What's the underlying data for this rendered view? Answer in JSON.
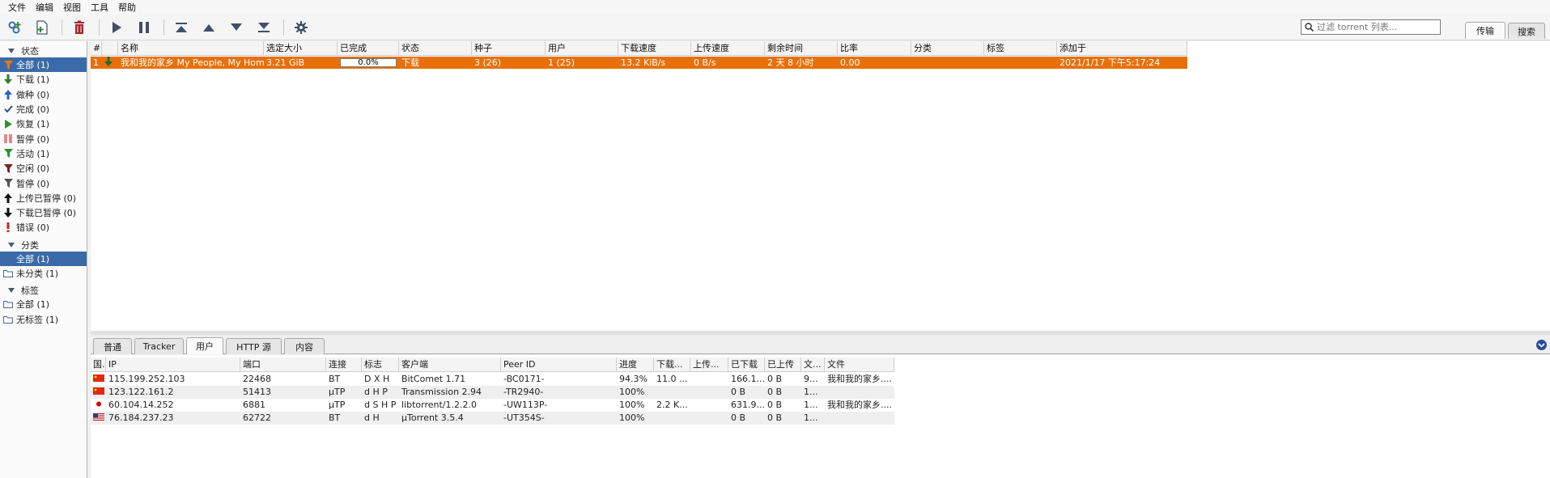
{
  "menubar": [
    "文件",
    "编辑",
    "视图",
    "工具",
    "帮助"
  ],
  "toolbar": {
    "filter_placeholder": "过滤 torrent 列表...",
    "tabs": [
      "传输",
      "搜索"
    ]
  },
  "sidebar": {
    "status_header": "状态",
    "status_items": [
      {
        "label": "全部 (1)",
        "icon": "filter-icon"
      },
      {
        "label": "下载 (1)",
        "icon": "download-arrow-icon"
      },
      {
        "label": "做种 (0)",
        "icon": "upload-arrow-icon"
      },
      {
        "label": "完成 (0)",
        "icon": "check-icon"
      },
      {
        "label": "恢复 (1)",
        "icon": "play-icon"
      },
      {
        "label": "暂停 (0)",
        "icon": "pause-icon"
      },
      {
        "label": "活动 (1)",
        "icon": "filter-icon"
      },
      {
        "label": "空闲 (0)",
        "icon": "filter-icon"
      },
      {
        "label": "暂停 (0)",
        "icon": "filter-icon"
      },
      {
        "label": "上传已暂停 (0)",
        "icon": "up-arrow-icon"
      },
      {
        "label": "下载已暂停 (0)",
        "icon": "down-arrow-icon"
      },
      {
        "label": "错误 (0)",
        "icon": "error-icon"
      }
    ],
    "category_header": "分类",
    "category_items": [
      "全部 (1)",
      "未分类 (1)"
    ],
    "tag_header": "标签",
    "tag_items": [
      "全部 (1)",
      "无标签 (1)"
    ]
  },
  "torrents": {
    "headers": [
      "#",
      "",
      "名称",
      "选定大小",
      "已完成",
      "状态",
      "种子",
      "用户",
      "下载速度",
      "上传速度",
      "剩余时间",
      "比率",
      "分类",
      "标签",
      "添加于"
    ],
    "rows": [
      {
        "num": "1",
        "name": "我和我的家乡 My People, My Hom...",
        "size": "3.21 GiB",
        "progress": "0.0%",
        "status": "下载",
        "seeds": "3 (26)",
        "peers": "1 (25)",
        "dl_speed": "13.2 KiB/s",
        "ul_speed": "0 B/s",
        "eta": "2 天 8 小时",
        "ratio": "0.00",
        "category": "",
        "tags": "",
        "added": "2021/1/17 下午5:17:24"
      }
    ]
  },
  "bottom_tabs": [
    "普通",
    "Tracker",
    "用户",
    "HTTP 源",
    "内容"
  ],
  "peers": {
    "headers": [
      "国.",
      "IP",
      "端口",
      "连接",
      "标志",
      "客户端",
      "Peer ID",
      "进度",
      "下载...",
      "上传...",
      "已下载",
      "已上传",
      "文...",
      "文件"
    ],
    "rows": [
      {
        "ip": "115.199.252.103",
        "port": "22468",
        "conn": "BT",
        "flags": "D X H",
        "client": "BitComet 1.71",
        "peer_id": "-BC0171-",
        "progress": "94.3%",
        "dl": "11.0 ...",
        "ul": "",
        "downloaded": "166.1...",
        "uploaded": "0 B",
        "files": "9...",
        "file": "我和我的家乡...."
      },
      {
        "ip": "123.122.161.2",
        "port": "51413",
        "conn": "μTP",
        "flags": "d H P",
        "client": "Transmission 2.94",
        "peer_id": "-TR2940-",
        "progress": "100%",
        "dl": "",
        "ul": "",
        "downloaded": "0 B",
        "uploaded": "0 B",
        "files": "1...",
        "file": ""
      },
      {
        "ip": "60.104.14.252",
        "port": "6881",
        "conn": "μTP",
        "flags": "d S H P",
        "client": "libtorrent/1.2.2.0",
        "peer_id": "-UW113P-",
        "progress": "100%",
        "dl": "2.2 K...",
        "ul": "",
        "downloaded": "631.9...",
        "uploaded": "0 B",
        "files": "1...",
        "file": "我和我的家乡...."
      },
      {
        "ip": "76.184.237.23",
        "port": "62722",
        "conn": "BT",
        "flags": "d H",
        "client": "μTorrent 3.5.4",
        "peer_id": "-UT354S-",
        "progress": "100%",
        "dl": "",
        "ul": "",
        "downloaded": "0 B",
        "uploaded": "0 B",
        "files": "1...",
        "file": ""
      }
    ]
  },
  "colors": {
    "accent": "#e8700a",
    "selection": "#3b6aa8"
  }
}
